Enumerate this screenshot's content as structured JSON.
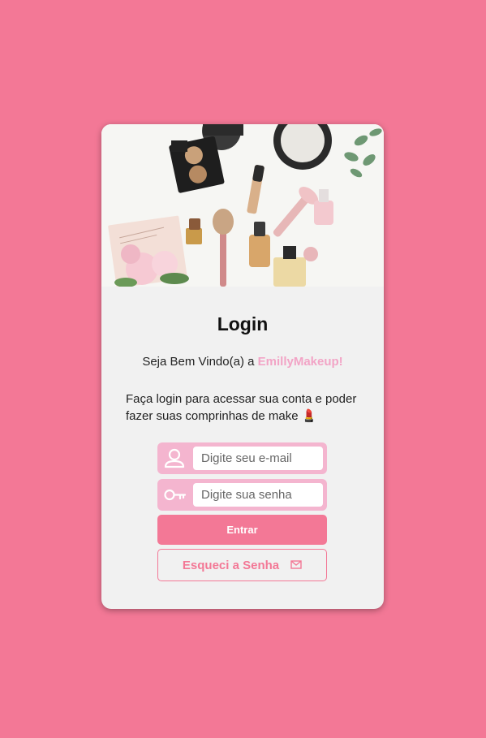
{
  "login": {
    "title": "Login",
    "welcome_prefix": "Seja Bem Vindo(a) a ",
    "brand_name": "EmillyMakeup!",
    "description": "Faça login para acessar sua conta e poder fazer suas comprinhas de make 💄",
    "email": {
      "placeholder": "Digite seu e-mail",
      "value": ""
    },
    "password": {
      "placeholder": "Digite sua senha",
      "value": ""
    },
    "submit_label": "Entrar",
    "forgot_label": "Esqueci a Senha"
  },
  "icons": {
    "email_field": "user-icon",
    "password_field": "key-icon",
    "forgot_button": "envelope-icon"
  },
  "colors": {
    "background": "#f37896",
    "card": "#f1f1f1",
    "accent": "#f37896",
    "field_bg": "#f4b5cf",
    "brand_text": "#f2a4c6"
  }
}
